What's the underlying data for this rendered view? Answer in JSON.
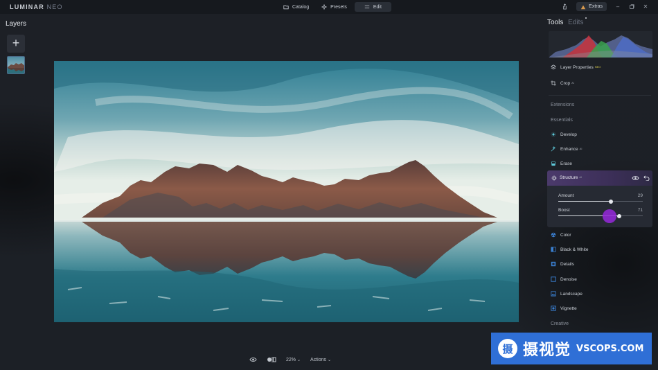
{
  "app": {
    "logo_main": "LUMINAR",
    "logo_sub": "NEO"
  },
  "topbar": {
    "modes": [
      {
        "label": "Catalog",
        "icon": "folder-icon",
        "active": false
      },
      {
        "label": "Presets",
        "icon": "sparkle-icon",
        "active": false
      },
      {
        "label": "Edit",
        "icon": "sliders-icon",
        "active": true
      }
    ],
    "extras_label": "Extras"
  },
  "layers": {
    "title": "Layers",
    "add_symbol": "+"
  },
  "bottombar": {
    "zoom": "22%",
    "actions_label": "Actions"
  },
  "panel": {
    "tab_tools": "Tools",
    "tab_edits": "Edits",
    "top_tools": [
      {
        "label": "Layer Properties",
        "badge": "NEO",
        "icon": "layers-icon"
      },
      {
        "label": "Crop",
        "badge": "AI",
        "icon": "crop-icon"
      }
    ],
    "section_extensions": "Extensions",
    "section_essentials": "Essentials",
    "essentials": [
      {
        "label": "Develop",
        "badge": "",
        "icon": "develop-icon"
      },
      {
        "label": "Enhance",
        "badge": "AI",
        "icon": "enhance-icon"
      },
      {
        "label": "Erase",
        "badge": "",
        "icon": "erase-icon"
      }
    ],
    "structure": {
      "label": "Structure",
      "badge": "AI",
      "sliders": [
        {
          "label": "Amount",
          "value": "29",
          "fraction": 0.62
        },
        {
          "label": "Boost",
          "value": "71",
          "fraction": 0.72
        }
      ]
    },
    "essentials_after": [
      {
        "label": "Color",
        "badge": "",
        "icon": "color-icon"
      },
      {
        "label": "Black & White",
        "badge": "",
        "icon": "black-white-icon"
      },
      {
        "label": "Details",
        "badge": "",
        "icon": "details-icon"
      },
      {
        "label": "Denoise",
        "badge": "",
        "icon": "denoise-icon"
      },
      {
        "label": "Landscape",
        "badge": "",
        "icon": "landscape-icon"
      },
      {
        "label": "Vignette",
        "badge": "",
        "icon": "vignette-icon"
      }
    ],
    "section_creative": "Creative"
  },
  "watermark": {
    "symbol": "摄",
    "chinese": "摄视觉",
    "latin": "VSCOPS.COM"
  },
  "colors": {
    "accent_purple": "#7b2fd0",
    "panel_bg": "#262a33",
    "watermark_blue": "#2f6fd6"
  }
}
